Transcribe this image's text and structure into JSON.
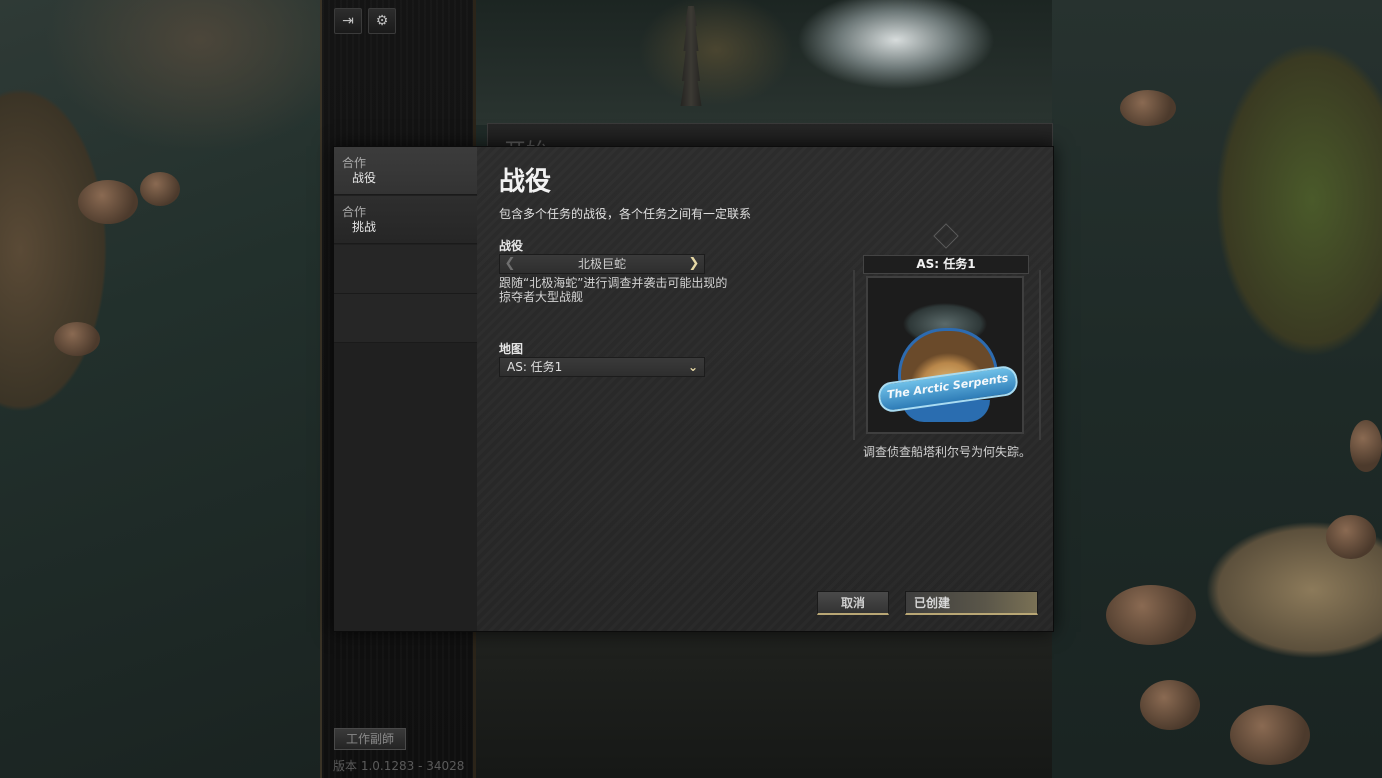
{
  "sidepanel": {
    "icons": [
      "exit-icon",
      "gear-icon"
    ],
    "workshop_label": "工作副師",
    "version_text": "版本 1.0.1283 - 34028"
  },
  "ghost_dialog": {
    "title": "开始"
  },
  "dialog": {
    "sidebar": {
      "items": [
        {
          "category": "合作",
          "label": "战役",
          "active": true
        },
        {
          "category": "合作",
          "label": "挑战",
          "active": false
        }
      ]
    },
    "title": "战役",
    "description": "包含多个任务的战役，各个任务之间有一定联系",
    "campaign": {
      "label": "战役",
      "value": "北极巨蛇",
      "prev_symbol": "❮",
      "next_symbol": "❯",
      "description": "跟随“北极海蛇”进行调查并袭击可能出现的掠夺者大型战舰"
    },
    "map": {
      "label": "地图",
      "value": "AS: 任务1",
      "caret": "⌄"
    },
    "preview": {
      "title": "AS: 任务1",
      "emblem_text": "The Arctic Serpents",
      "description": "调查侦查船塔利尔号为何失踪。"
    },
    "buttons": {
      "cancel": "取消",
      "create": "已创建"
    }
  },
  "colors": {
    "accent_gold": "#b9a775",
    "arrow_gold": "#e7d9a6"
  }
}
